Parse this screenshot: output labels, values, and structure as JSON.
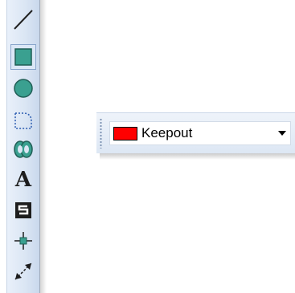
{
  "toolbar": {
    "tools": [
      {
        "name": "line",
        "icon": "line-icon"
      },
      {
        "name": "rectangle",
        "icon": "rectangle-icon",
        "selected": true
      },
      {
        "name": "circle",
        "icon": "circle-icon"
      },
      {
        "name": "polygon",
        "icon": "polygon-icon"
      },
      {
        "name": "rings",
        "icon": "rings-icon"
      },
      {
        "name": "text",
        "icon": "text-icon",
        "glyph": "A"
      },
      {
        "name": "s-symbol",
        "icon": "s-symbol-icon"
      },
      {
        "name": "crosshair",
        "icon": "crosshair-icon"
      },
      {
        "name": "dimension",
        "icon": "dimension-icon"
      }
    ]
  },
  "layer_dropdown": {
    "selected_label": "Keepout",
    "swatch_color": "#ff0000",
    "arrow_icon": "dropdown-arrow-icon"
  },
  "colors": {
    "icon_fill": "#3aa090",
    "selection_border": "#8aa6cc"
  }
}
